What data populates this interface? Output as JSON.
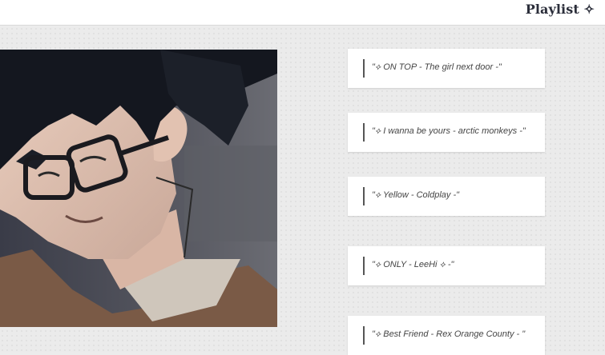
{
  "header": {
    "title": "Playlist ✧"
  },
  "playlist": {
    "tracks": [
      {
        "label": "\"⟡ ON TOP - The girl next door  -\""
      },
      {
        "label": "\"⟡ I wanna be yours - arctic monkeys -\""
      },
      {
        "label": "\"⟡ Yellow - Coldplay -\""
      },
      {
        "label": "\"⟡ ONLY - LeeHi ⟡ -\""
      },
      {
        "label": "\"⟡ Best Friend - Rex Orange County - \""
      }
    ]
  },
  "colors": {
    "header_bg": "#ffffff",
    "page_bg": "#ebebeb",
    "title_text": "#2b2e3a",
    "card_bg": "#ffffff",
    "card_bar": "#555555"
  }
}
